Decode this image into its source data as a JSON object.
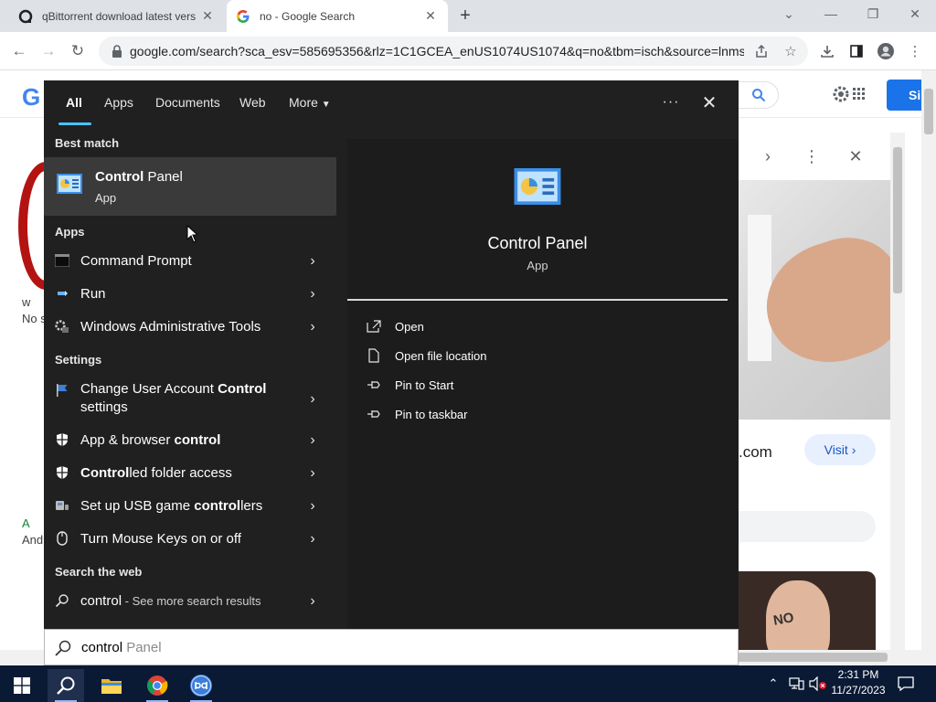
{
  "browser": {
    "tabs": [
      {
        "title": "qBittorrent download latest vers",
        "active": false
      },
      {
        "title": "no - Google Search",
        "active": true
      }
    ],
    "url": "google.com/search?sca_esv=585695356&rlz=1C1GCEA_enUS1074US1074&q=no&tbm=isch&source=lnms..."
  },
  "page_bg": {
    "logo_letter": "G",
    "signin_label": "Si",
    "snippet1": "w",
    "snippet2": "No s",
    "snippet3": "A",
    "snippet4": "And",
    "domain_suffix": ".com",
    "visit_label": "Visit",
    "no_text": "NO"
  },
  "start_search": {
    "tabs": [
      "All",
      "Apps",
      "Documents",
      "Web",
      "More"
    ],
    "sections": {
      "best_match": "Best match",
      "apps": "Apps",
      "settings": "Settings",
      "web": "Search the web"
    },
    "best_match": {
      "name_bold": "Control",
      "name_rest": " Panel",
      "type": "App"
    },
    "apps": [
      {
        "label": "Command Prompt"
      },
      {
        "label": "Run"
      },
      {
        "label": "Windows Administrative Tools"
      }
    ],
    "settings": [
      {
        "pre": "Change User Account ",
        "bold": "Control",
        "post": " settings"
      },
      {
        "pre": "App & browser ",
        "bold": "control",
        "post": ""
      },
      {
        "pre": "",
        "bold": "Control",
        "post": "led folder access"
      },
      {
        "pre": "Set up USB game ",
        "bold": "control",
        "post": "lers"
      },
      {
        "pre": "Turn Mouse Keys on or off",
        "bold": "",
        "post": ""
      }
    ],
    "web": {
      "query": "control",
      "suffix": " - See more search results"
    },
    "preview": {
      "title": "Control Panel",
      "type": "App",
      "actions": [
        "Open",
        "Open file location",
        "Pin to Start",
        "Pin to taskbar"
      ]
    },
    "search_box": {
      "typed": "control",
      "ghost": " Panel"
    }
  },
  "taskbar": {
    "time": "2:31 PM",
    "date": "11/27/2023"
  },
  "colors": {
    "accent": "#4cc2ff",
    "start_bg": "#202020",
    "taskbar_bg": "#0b1a34",
    "google_blue": "#1a73e8"
  }
}
